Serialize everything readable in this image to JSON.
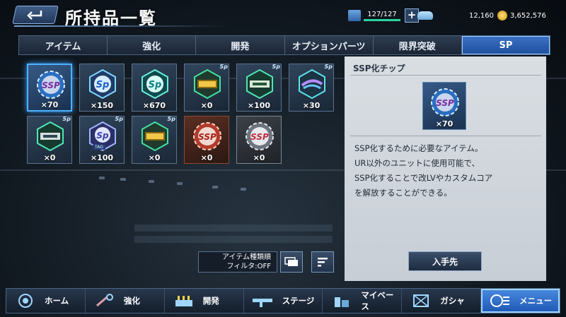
{
  "header": {
    "title": "所持品一覧",
    "back_icon": "back-arrow-icon",
    "stamina": "127/127",
    "gems": "12,160",
    "coins": "3,652,576",
    "plus_label": "+"
  },
  "tabs": [
    {
      "label": "アイテム",
      "active": false
    },
    {
      "label": "強化",
      "active": false
    },
    {
      "label": "開発",
      "active": false
    },
    {
      "label": "オプションパーツ",
      "active": false
    },
    {
      "label": "限界突破",
      "active": false
    },
    {
      "label": "SP",
      "active": true
    }
  ],
  "items": [
    {
      "count": "×70",
      "tag": "",
      "selected": true,
      "style": "ssp-chip"
    },
    {
      "count": "×150",
      "tag": "sp",
      "selected": false,
      "style": "sp-blue"
    },
    {
      "count": "×670",
      "tag": "sp",
      "selected": false,
      "style": "sp-teal"
    },
    {
      "count": "×0",
      "tag": "sp",
      "selected": false,
      "style": "sp-gold"
    },
    {
      "count": "×100",
      "tag": "sp",
      "selected": false,
      "style": "sp-green"
    },
    {
      "count": "×30",
      "tag": "sp",
      "selected": false,
      "style": "sp-purple"
    },
    {
      "count": "×0",
      "tag": "sp",
      "selected": false,
      "style": "sp-green2"
    },
    {
      "count": "×100",
      "tag": "sp",
      "selected": false,
      "style": "sp-tag",
      "label": "TAG"
    },
    {
      "count": "×0",
      "tag": "sp",
      "selected": false,
      "style": "sp-gold2"
    },
    {
      "count": "×0",
      "tag": "",
      "selected": false,
      "style": "ssp-red"
    },
    {
      "count": "×0",
      "tag": "",
      "selected": false,
      "style": "ssp-grey"
    }
  ],
  "filter": {
    "sort_label": "アイテム種類順",
    "filter_label": "フィルタ:OFF"
  },
  "detail": {
    "title": "SSP化チップ",
    "count": "×70",
    "description": [
      "SSP化するために必要なアイテム。",
      "UR以外のユニットに使用可能で、",
      "SSP化することで改LVやカスタムコア",
      "を解放することができる。"
    ],
    "acquire_label": "入手先"
  },
  "nav": [
    {
      "label": "ホーム",
      "icon": "home-icon",
      "active": false
    },
    {
      "label": "強化",
      "icon": "wrench-icon",
      "active": false
    },
    {
      "label": "開発",
      "icon": "factory-icon",
      "active": false
    },
    {
      "label": "ステージ",
      "icon": "weapon-icon",
      "active": false
    },
    {
      "label": "マイベース",
      "icon": "base-icon",
      "active": false
    },
    {
      "label": "ガシャ",
      "icon": "gacha-icon",
      "active": false
    },
    {
      "label": "メニュー",
      "icon": "menu-icon",
      "active": true
    }
  ],
  "colors": {
    "accent": "#3d72c4",
    "highlight": "#4db2ff",
    "panel": "#d9dee3"
  }
}
